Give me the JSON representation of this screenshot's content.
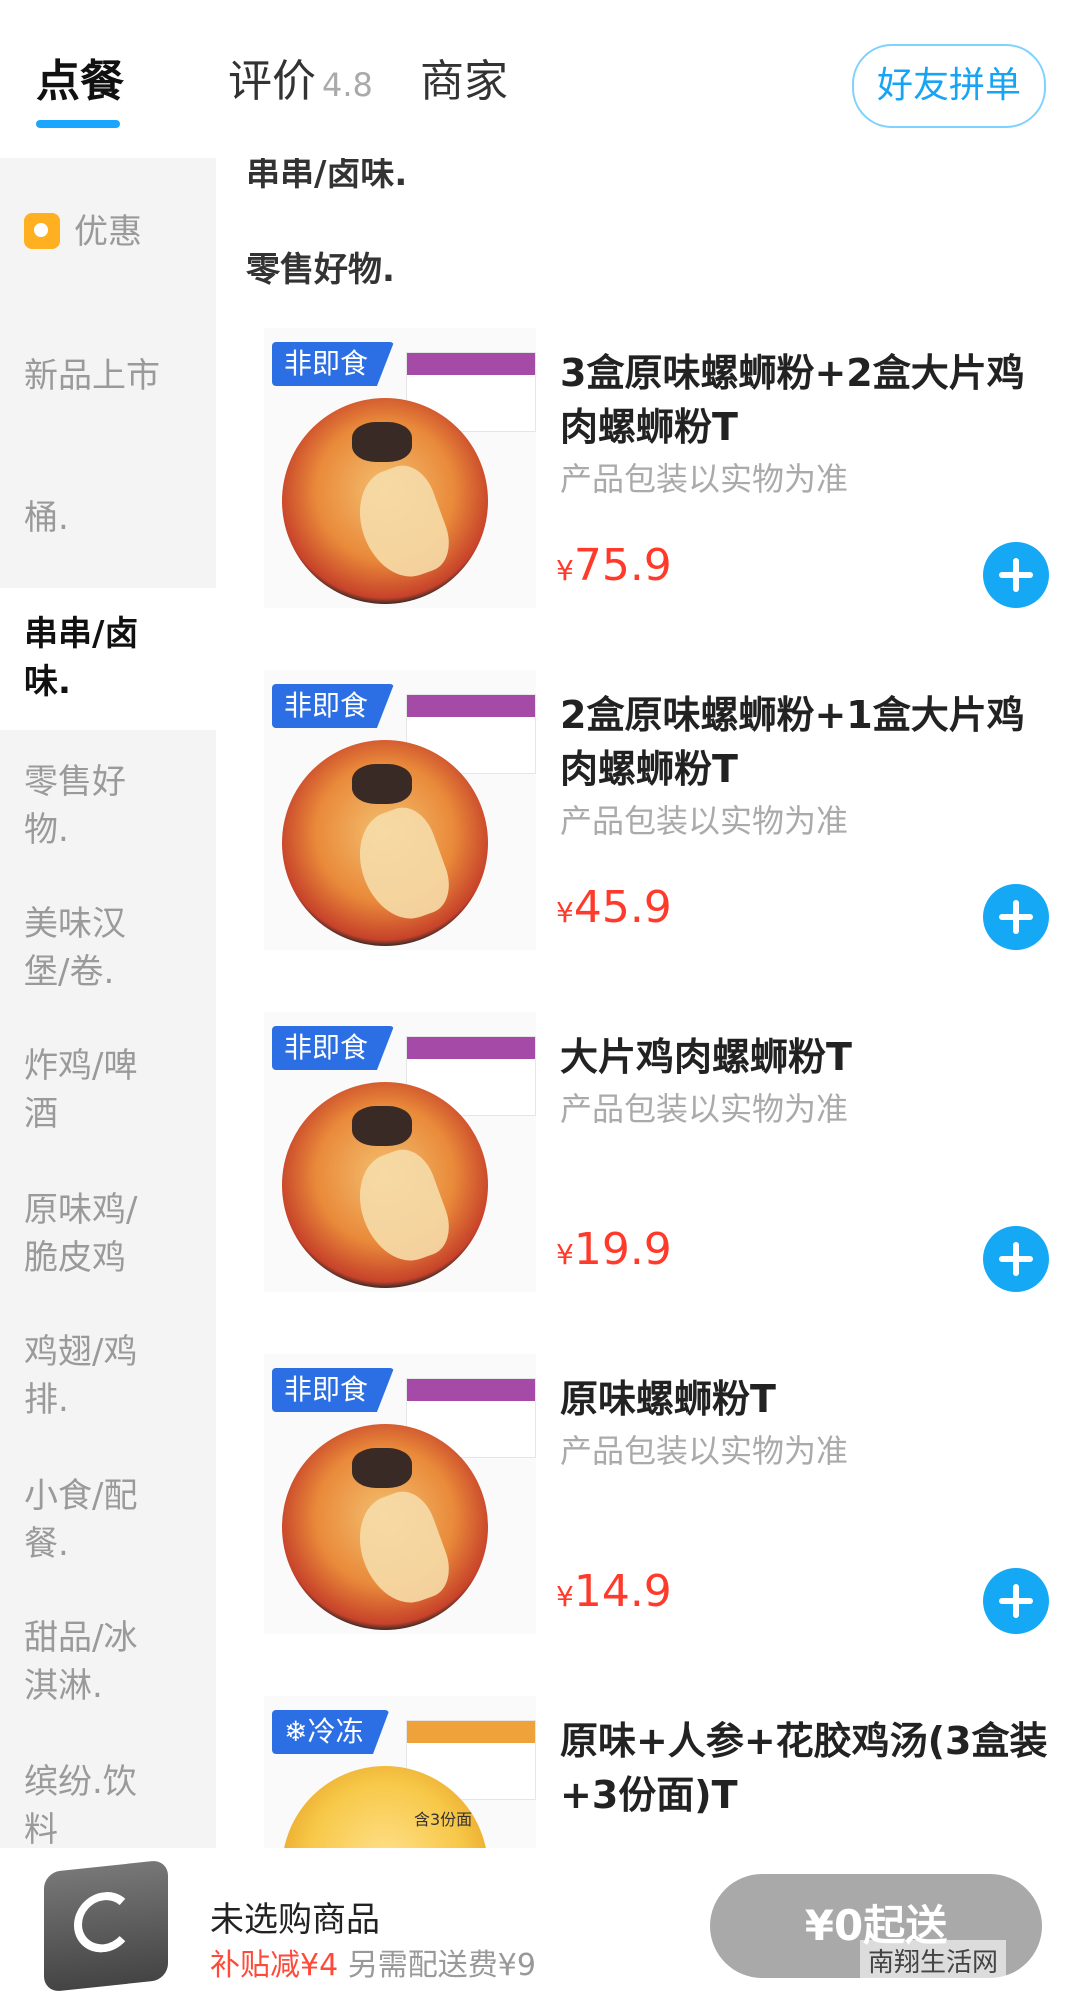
{
  "tabs": {
    "order": "点餐",
    "reviews": "评价",
    "rating": "4.8",
    "merchant": "商家",
    "group_order": "好友拼单"
  },
  "sidebar": {
    "items": [
      {
        "label": "优惠"
      },
      {
        "label": "新品上市"
      },
      {
        "label": "桶."
      },
      {
        "label": "串串/卤味."
      },
      {
        "label": "零售好物."
      },
      {
        "label": "美味汉堡/卷."
      },
      {
        "label": "炸鸡/啤酒"
      },
      {
        "label": "原味鸡/脆皮鸡"
      },
      {
        "label": "鸡翅/鸡排."
      },
      {
        "label": "小食/配餐."
      },
      {
        "label": "甜品/冰淇淋."
      },
      {
        "label": "缤纷.饮料"
      }
    ]
  },
  "main": {
    "headings": [
      "串串/卤味.",
      "零售好物."
    ],
    "products": [
      {
        "tag": "非即食",
        "name": "3盒原味螺蛳粉+2盒大片鸡肉螺蛳粉T",
        "desc": "产品包装以实物为准",
        "price_symbol": "¥",
        "price": "75.9"
      },
      {
        "tag": "非即食",
        "name": "2盒原味螺蛳粉+1盒大片鸡肉螺蛳粉T",
        "desc": "产品包装以实物为准",
        "price_symbol": "¥",
        "price": "45.9"
      },
      {
        "tag": "非即食",
        "name": "大片鸡肉螺蛳粉T",
        "desc": "产品包装以实物为准",
        "price_symbol": "¥",
        "price": "19.9"
      },
      {
        "tag": "非即食",
        "name": "原味螺蛳粉T",
        "desc": "产品包装以实物为准",
        "price_symbol": "¥",
        "price": "14.9"
      },
      {
        "tag": "❄冷冻",
        "name": "原味+人参+花胶鸡汤(3盒装+3份面)T",
        "note": "含3份面"
      }
    ]
  },
  "footer": {
    "status": "未选购商品",
    "subsidy": "补贴减¥4",
    "delivery_fee": "另需配送费¥9",
    "checkout": "¥0起送",
    "watermark": "南翔生活网"
  }
}
